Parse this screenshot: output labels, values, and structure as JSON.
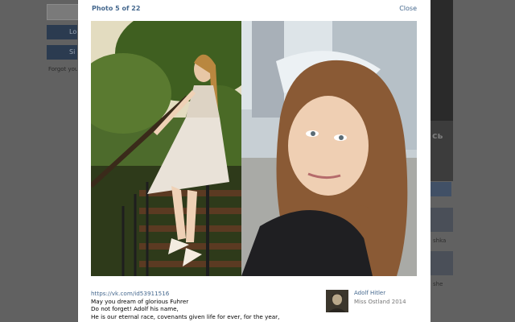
{
  "background": {
    "login_button_1": "Lo",
    "login_button_2": "Si",
    "forgot_text": "Forgot you",
    "right_word": "сь",
    "right_text_1": "shka",
    "right_text_2": "she"
  },
  "modal": {
    "title": "Photo 5 of 22",
    "close_label": "Close"
  },
  "caption": {
    "link": "https://vk.com/id53911516",
    "lines": [
      "May you dream of glorious Fuhrer",
      "Do not forget! Adolf his name,",
      "He is our eternal race, covenants given life for ever, for the year,"
    ]
  },
  "author": {
    "name": "Adolf Hitler",
    "subtitle": "Miss Ostland 2014"
  },
  "colors": {
    "link": "#45688e",
    "overlay": "#5d5d5d"
  }
}
